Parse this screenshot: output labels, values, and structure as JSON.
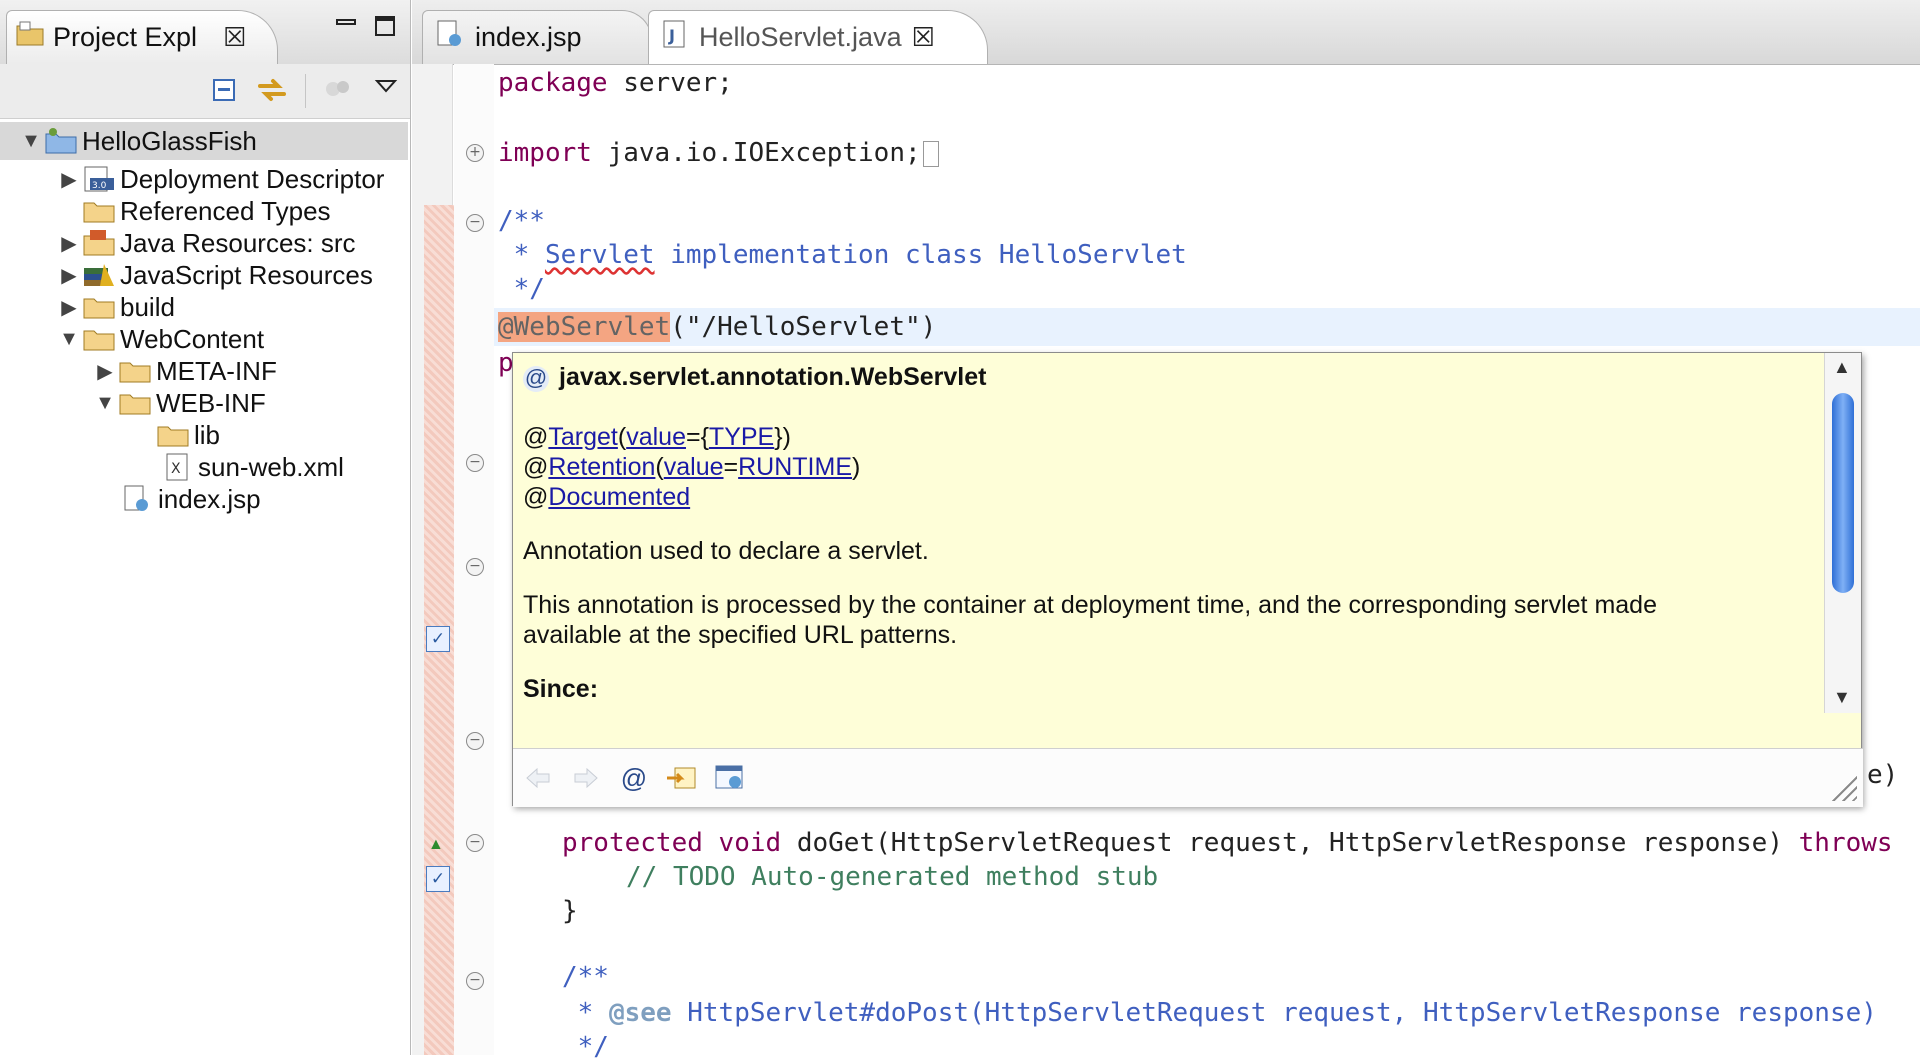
{
  "explorer": {
    "tab_label": "Project Expl",
    "close_glyph": "☒",
    "minimize_glyph": "▭",
    "maximize_glyph": "☐",
    "toolbar_icons": [
      "collapse-all-icon",
      "link-with-editor-icon",
      "filters-icon",
      "view-menu-icon"
    ],
    "tree": [
      {
        "label": "HelloGlassFish",
        "icon": "project-icon",
        "twisty": "▼"
      },
      {
        "label": "Deployment Descriptor",
        "icon": "deployment-descriptor-icon",
        "twisty": "▶"
      },
      {
        "label": "Referenced Types",
        "icon": "folder-icon",
        "twisty": ""
      },
      {
        "label": "Java Resources: src",
        "icon": "java-resources-icon",
        "twisty": "▶"
      },
      {
        "label": "JavaScript Resources",
        "icon": "javascript-resources-icon",
        "twisty": "▶"
      },
      {
        "label": "build",
        "icon": "folder-icon",
        "twisty": "▶"
      },
      {
        "label": "WebContent",
        "icon": "folder-icon",
        "twisty": "▼"
      },
      {
        "label": "META-INF",
        "icon": "folder-icon",
        "twisty": "▶"
      },
      {
        "label": "WEB-INF",
        "icon": "folder-icon",
        "twisty": "▼"
      },
      {
        "label": "lib",
        "icon": "folder-icon",
        "twisty": ""
      },
      {
        "label": "sun-web.xml",
        "icon": "xml-file-icon",
        "twisty": ""
      },
      {
        "label": "index.jsp",
        "icon": "jsp-file-icon",
        "twisty": ""
      }
    ]
  },
  "editor": {
    "tabs": [
      {
        "label": "index.jsp",
        "icon": "jsp-file-icon"
      },
      {
        "label": "HelloServlet.java",
        "icon": "java-file-icon",
        "close": "☒"
      }
    ],
    "code": {
      "l1_kw": "package",
      "l1_rest": " server;",
      "l2_kw": "import",
      "l2_rest": " java.io.IOException;",
      "l3": "/**",
      "l4_pre": " * ",
      "l4_err": "Servlet",
      "l4_rest": " implementation class HelloServlet",
      "l5": " */",
      "l6_ann": "@WebServlet",
      "l6_str": "(\"/HelloServlet\")",
      "l7_partial": "p",
      "l_tail": "e)",
      "l8_kw1": "protected",
      "l8_kw2": "void",
      "l8_rest": " doGet(HttpServletRequest request, HttpServletResponse response) ",
      "l8_kw3": "throws",
      "l9": "// TODO Auto-generated method stub",
      "l10": "}",
      "l11": "/**",
      "l12_pre": " * ",
      "l12_tag": "@see",
      "l12_rest": " HttpServlet#doPost(HttpServletRequest request, HttpServletResponse response)",
      "l13": " */"
    }
  },
  "hover": {
    "title": "javax.servlet.annotation.WebServlet",
    "at": "@",
    "line1": {
      "at": "@",
      "target": "Target",
      "paren_open": "(",
      "value": "value",
      "eq": "={",
      "type": "TYPE",
      "close": "})"
    },
    "line2": {
      "at": "@",
      "retention": "Retention",
      "paren_open": "(",
      "value": "value",
      "eq": "=",
      "runtime": "RUNTIME",
      "close": ")"
    },
    "line3": {
      "at": "@",
      "documented": "Documented"
    },
    "desc1": "Annotation used to declare a servlet.",
    "desc2a": "This annotation is processed by the container at deployment time, and the corresponding servlet made",
    "desc2b": "available at the specified URL patterns.",
    "since": "Since:",
    "toolbar": [
      "back-icon",
      "forward-icon",
      "at-sign-icon",
      "open-declaration-icon",
      "open-in-javadoc-view-icon"
    ],
    "toolbar_at": "@"
  },
  "colors": {
    "keyword": "#7f0055",
    "javadoc": "#3f5fbf",
    "comment": "#3f7f5f",
    "string": "#2a00ff",
    "annotation_highlight": "#f4a582",
    "hover_bg": "#fefed8"
  }
}
